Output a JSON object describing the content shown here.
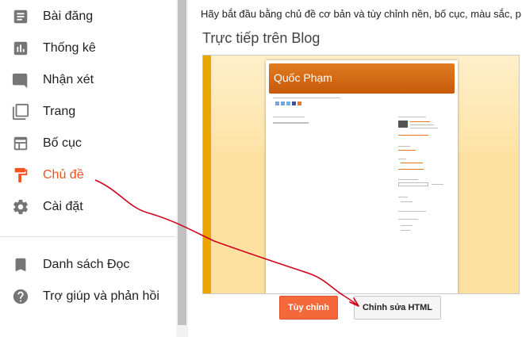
{
  "sidebar": {
    "items": [
      {
        "label": "Bài đăng",
        "icon": "posts-icon"
      },
      {
        "label": "Thống kê",
        "icon": "stats-icon"
      },
      {
        "label": "Nhận xét",
        "icon": "comments-icon"
      },
      {
        "label": "Trang",
        "icon": "pages-icon"
      },
      {
        "label": "Bố cục",
        "icon": "layout-icon"
      },
      {
        "label": "Chủ đề",
        "icon": "theme-icon"
      },
      {
        "label": "Cài đặt",
        "icon": "settings-icon"
      }
    ],
    "secondary": [
      {
        "label": "Danh sách Đọc",
        "icon": "bookmark-icon"
      },
      {
        "label": "Trợ giúp và phản hồi",
        "icon": "help-icon"
      }
    ],
    "active_color": "#f4511e"
  },
  "main": {
    "intro": "Hãy bắt đầu bằng chủ đề cơ bản và tùy chỉnh nền, bố cục, màu sắc, p",
    "live_heading": "Trực tiếp trên Blog",
    "preview": {
      "blog_title": "Quốc Phạm"
    },
    "buttons": {
      "customize": "Tùy chỉnh",
      "edit_html": "Chỉnh sửa HTML"
    }
  },
  "colors": {
    "accent": "#f4683c",
    "annotation": "#d0021b"
  }
}
